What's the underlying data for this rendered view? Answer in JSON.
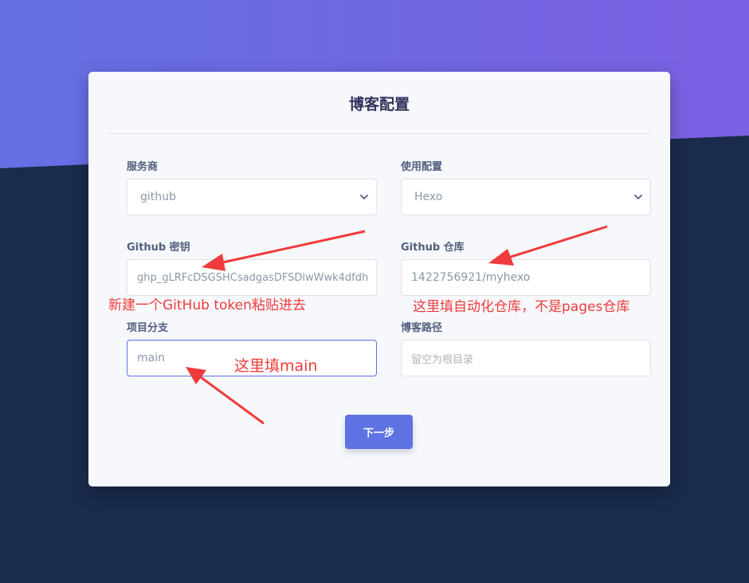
{
  "form": {
    "title": "博客配置",
    "provider": {
      "label": "服务商",
      "value": "github"
    },
    "config": {
      "label": "使用配置",
      "value": "Hexo"
    },
    "token": {
      "label": "Github 密钥",
      "value": "ghp_gLRFcDSGSHCsadgasDFSDlwWwk4dfdh"
    },
    "repo": {
      "label": "Github 仓库",
      "value": "1422756921/myhexo"
    },
    "branch": {
      "label": "项目分支",
      "value": "main"
    },
    "path": {
      "label": "博客路径",
      "placeholder": "留空为根目录"
    },
    "next_label": "下一步"
  },
  "annotations": {
    "token_note": "新建一个GitHub token粘贴进去",
    "repo_note": "这里填自动化仓库，不是pages仓库",
    "branch_note": "这里填main"
  },
  "colors": {
    "accent": "#5e72e4",
    "annotation": "#ef3b3b",
    "gradient_start": "#6470e3",
    "gradient_end": "#7c60e3",
    "background_dark": "#1a2b4b"
  },
  "icons": {
    "select_arrow": "chevron-down-icon",
    "annotation_arrow": "red-arrow-icon"
  }
}
